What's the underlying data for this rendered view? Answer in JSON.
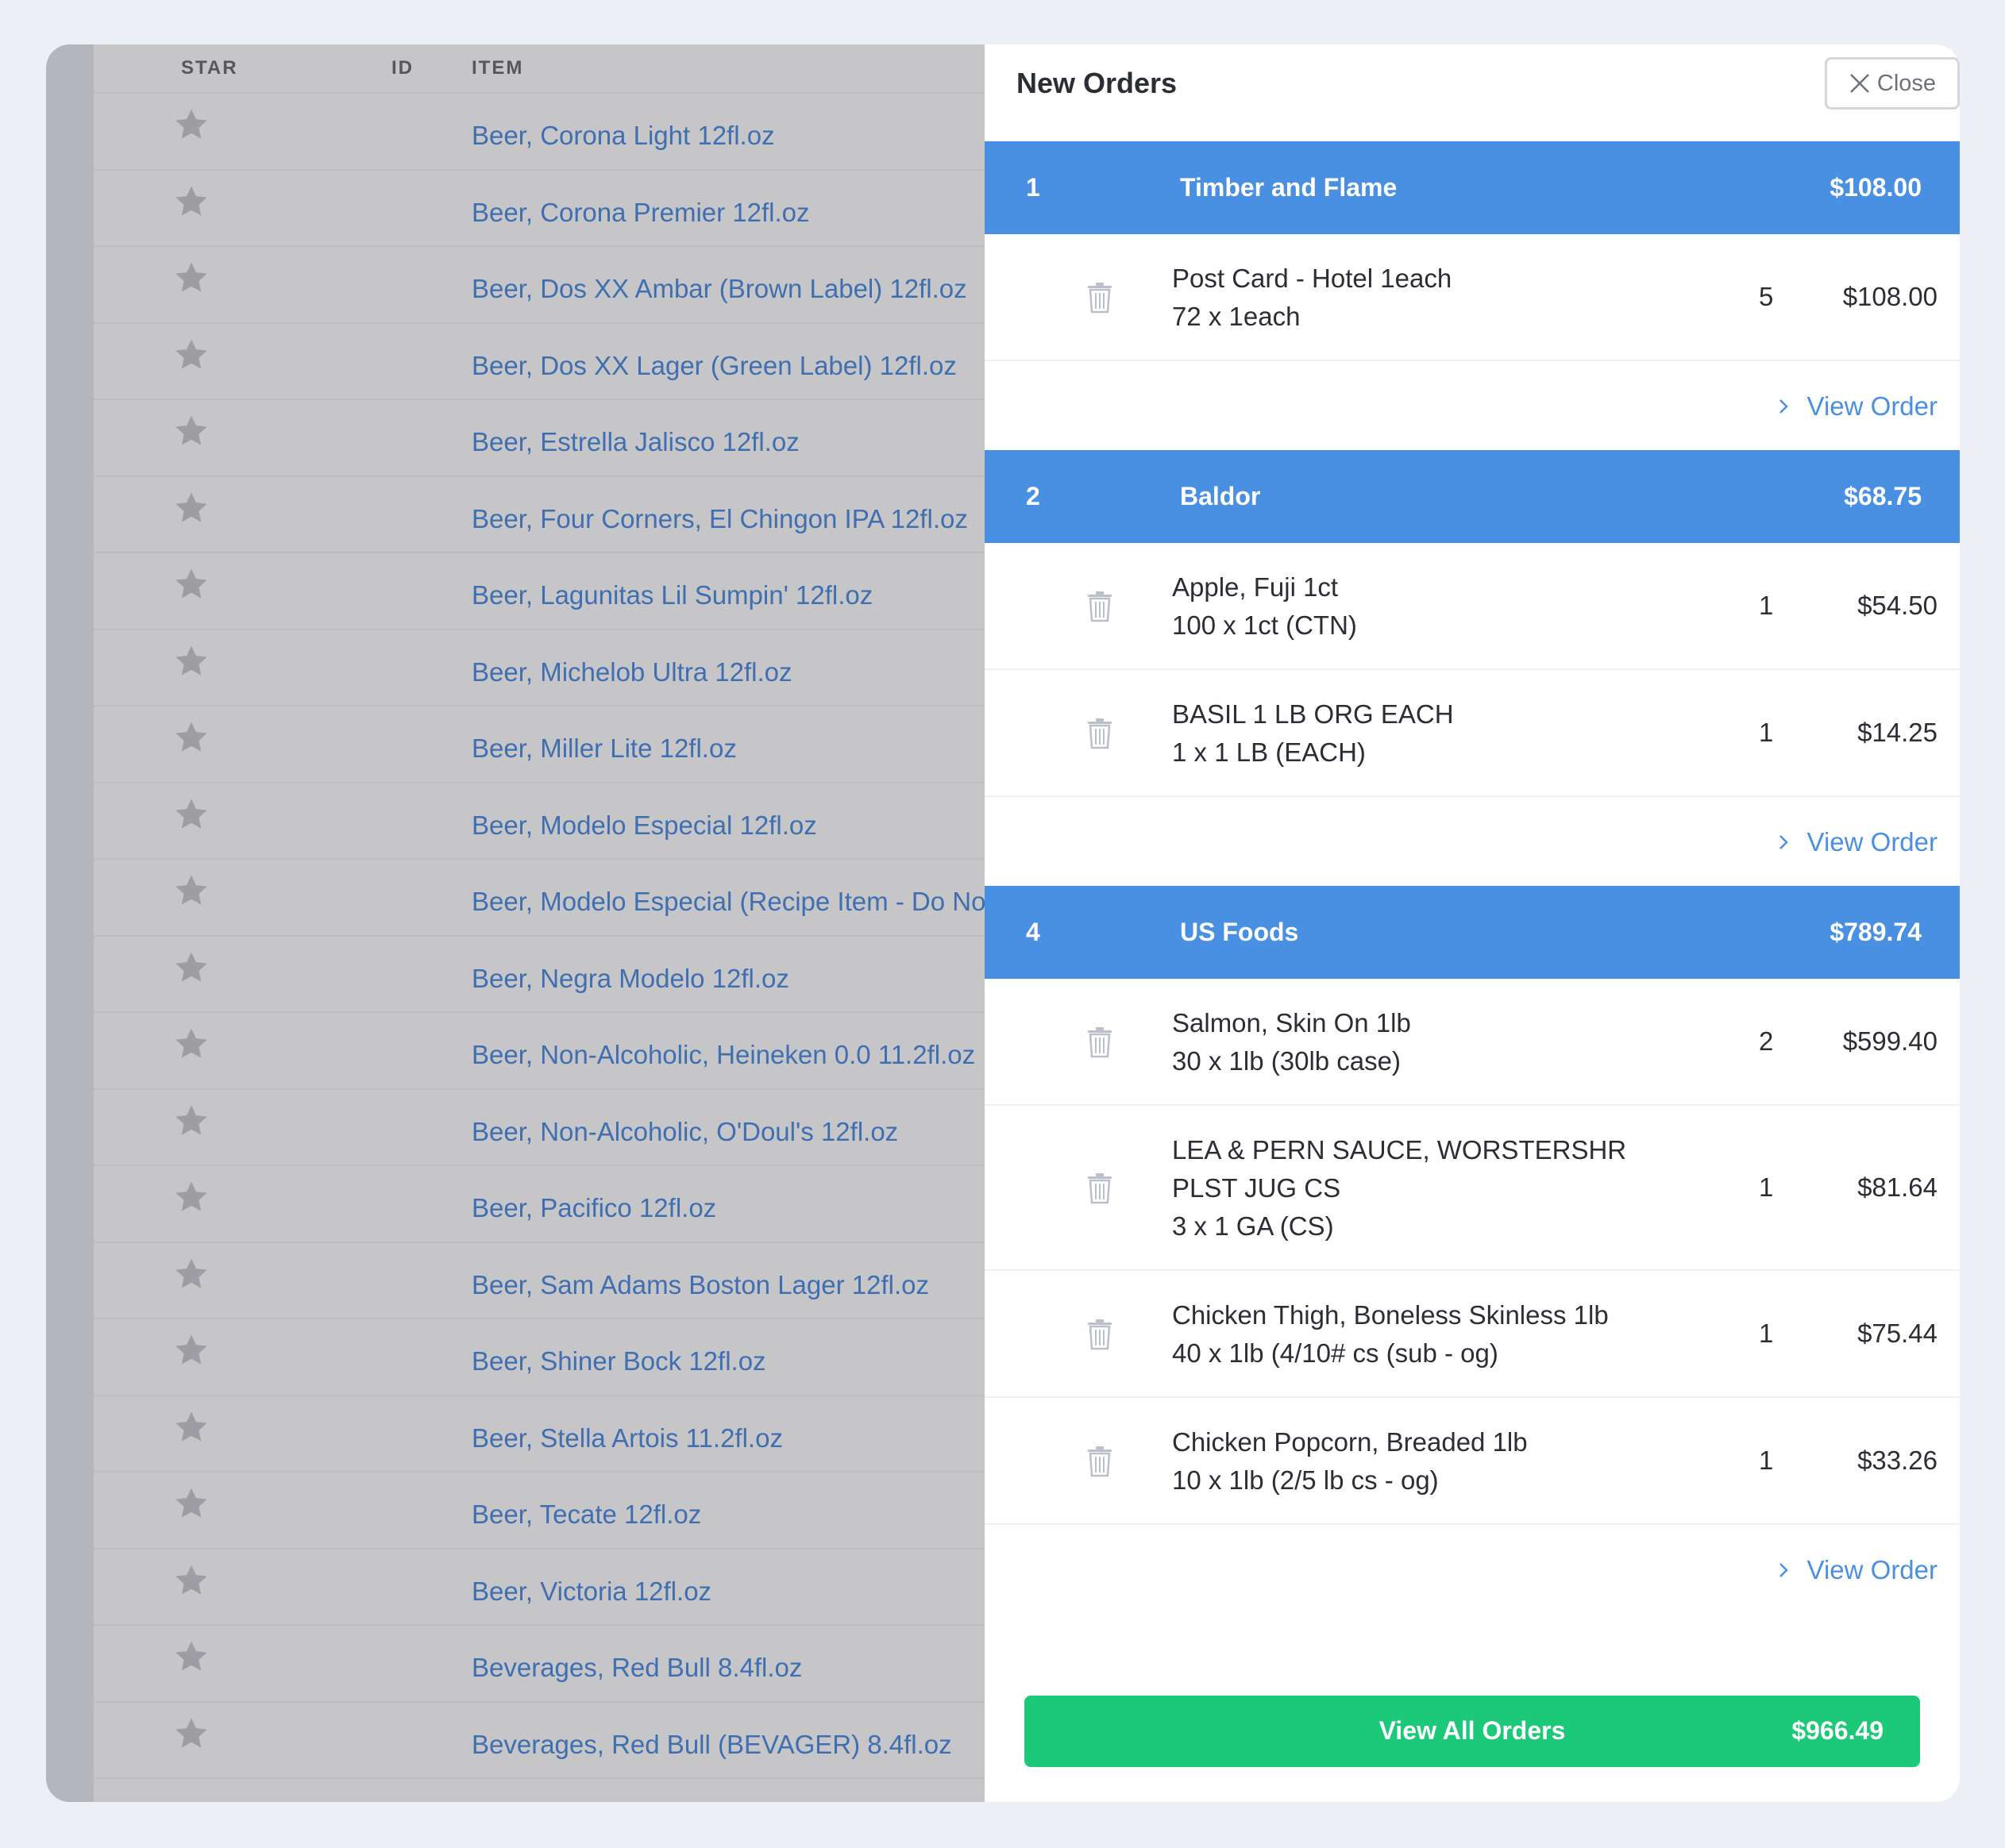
{
  "table": {
    "headers": {
      "star": "STAR",
      "id": "ID",
      "item": "ITEM"
    },
    "rows": [
      "Beer, Corona Light 12fl.oz",
      "Beer, Corona Premier 12fl.oz",
      "Beer, Dos XX Ambar (Brown Label) 12fl.oz",
      "Beer, Dos XX Lager (Green Label) 12fl.oz",
      "Beer, Estrella Jalisco 12fl.oz",
      "Beer, Four Corners, El Chingon IPA 12fl.oz",
      "Beer, Lagunitas Lil Sumpin' 12fl.oz",
      "Beer, Michelob Ultra 12fl.oz",
      "Beer, Miller Lite 12fl.oz",
      "Beer, Modelo Especial 12fl.oz",
      "Beer, Modelo Especial (Recipe Item - Do Not Auc",
      "Beer, Negra Modelo 12fl.oz",
      "Beer, Non-Alcoholic, Heineken 0.0 11.2fl.oz",
      "Beer, Non-Alcoholic, O'Doul's 12fl.oz",
      "Beer, Pacifico 12fl.oz",
      "Beer, Sam Adams Boston Lager 12fl.oz",
      "Beer, Shiner Bock 12fl.oz",
      "Beer, Stella Artois 11.2fl.oz",
      "Beer, Tecate 12fl.oz",
      "Beer, Victoria 12fl.oz",
      "Beverages, Red Bull 8.4fl.oz",
      "Beverages, Red Bull (BEVAGER) 8.4fl.oz"
    ]
  },
  "panel": {
    "title": "New Orders",
    "close_label": "Close",
    "view_order_label": "View Order",
    "view_all_label": "View All Orders",
    "grand_total": "$966.49",
    "vendors": [
      {
        "number": "1",
        "name": "Timber and Flame",
        "total": "$108.00",
        "items": [
          {
            "lines": [
              "Post Card - Hotel 1each",
              "72 x 1each"
            ],
            "qty": "5",
            "price": "$108.00"
          }
        ]
      },
      {
        "number": "2",
        "name": "Baldor",
        "total": "$68.75",
        "items": [
          {
            "lines": [
              "Apple, Fuji 1ct",
              "100 x 1ct (CTN)"
            ],
            "qty": "1",
            "price": "$54.50"
          },
          {
            "lines": [
              "BASIL 1 LB ORG EACH",
              "1 x 1 LB (EACH)"
            ],
            "qty": "1",
            "price": "$14.25"
          }
        ]
      },
      {
        "number": "4",
        "name": "US Foods",
        "total": "$789.74",
        "items": [
          {
            "lines": [
              "Salmon, Skin On 1lb",
              "30 x 1lb (30lb case)"
            ],
            "qty": "2",
            "price": "$599.40"
          },
          {
            "lines": [
              "LEA & PERN SAUCE, WORSTERSHR",
              "PLST JUG CS",
              "3 x 1 GA (CS)"
            ],
            "qty": "1",
            "price": "$81.64"
          },
          {
            "lines": [
              "Chicken Thigh, Boneless Skinless 1lb",
              "40 x 1lb (4/10# cs (sub - og)"
            ],
            "qty": "1",
            "price": "$75.44"
          },
          {
            "lines": [
              "Chicken Popcorn, Breaded 1lb",
              "10 x 1lb (2/5 lb cs - og)"
            ],
            "qty": "1",
            "price": "$33.26"
          }
        ]
      }
    ]
  },
  "colors": {
    "vendor_bar": "#4a90e2",
    "link": "#4a90e2",
    "primary_button": "#1cc978",
    "table_link": "#3f6fb0",
    "overlay": "#c6c6c8"
  },
  "icons": {
    "star": "star-icon",
    "trash": "trash-icon",
    "close": "close-icon",
    "chevron": "chevron-right-icon"
  }
}
